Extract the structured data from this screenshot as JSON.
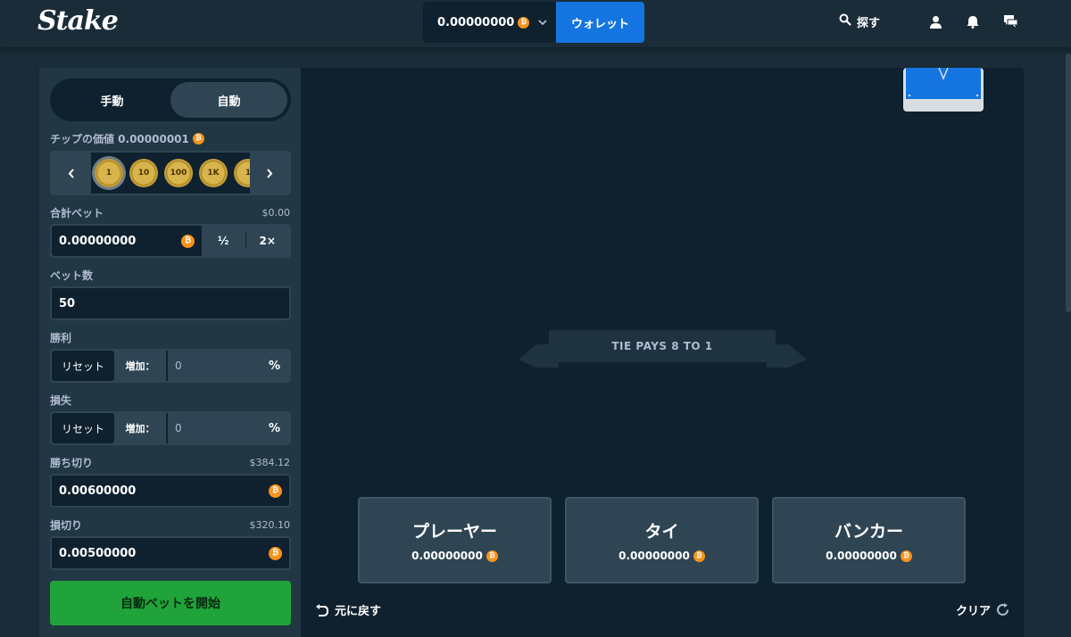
{
  "header": {
    "logo": "Stake",
    "balance": "0.00000000",
    "wallet_label": "ウォレット",
    "search_label": "探す"
  },
  "sidebar": {
    "mode_tabs": [
      {
        "label": "手動",
        "active": false
      },
      {
        "label": "自動",
        "active": true
      }
    ],
    "chip_value_label": "チップの価値 0.00000001",
    "chips": [
      "1",
      "10",
      "100",
      "1K",
      "1"
    ],
    "total_bet": {
      "label": "合計ベット",
      "usd": "$0.00",
      "value": "0.00000000",
      "half": "½",
      "double": "2×"
    },
    "bet_count": {
      "label": "ベット数",
      "value": "50"
    },
    "on_win": {
      "label": "勝利",
      "reset": "リセット",
      "increase": "増加：",
      "value": "0",
      "unit": "%"
    },
    "on_loss": {
      "label": "損失",
      "reset": "リセット",
      "increase": "増加：",
      "value": "0",
      "unit": "%"
    },
    "stop_profit": {
      "label": "勝ち切り",
      "usd": "$384.12",
      "value": "0.00600000"
    },
    "stop_loss": {
      "label": "損切り",
      "usd": "$320.10",
      "value": "0.00500000"
    },
    "start_button": "自動ベットを開始"
  },
  "game": {
    "tie_banner": "TIE PAYS 8 TO 1",
    "bet_spots": [
      {
        "name": "プレーヤー",
        "amount": "0.00000000"
      },
      {
        "name": "タイ",
        "amount": "0.00000000"
      },
      {
        "name": "バンカー",
        "amount": "0.00000000"
      }
    ],
    "undo_label": "元に戻す",
    "clear_label": "クリア"
  },
  "colors": {
    "accent": "#1475e1",
    "start": "#1fa33a",
    "coin": "#f7931a",
    "panel": "#213743",
    "game_bg": "#0f212e"
  }
}
